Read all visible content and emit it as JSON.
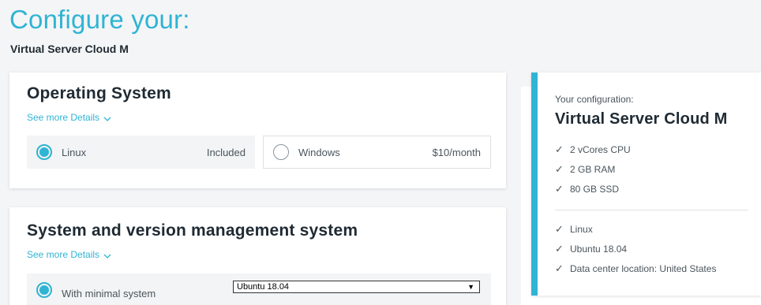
{
  "header": {
    "title": "Configure your:",
    "subtitle": "Virtual Server Cloud M"
  },
  "os_section": {
    "title": "Operating System",
    "details_link": "See more Details",
    "options": [
      {
        "label": "Linux",
        "price": "Included",
        "selected": true
      },
      {
        "label": "Windows",
        "price": "$10/month",
        "selected": false
      }
    ]
  },
  "system_section": {
    "title": "System and version management system",
    "details_link": "See more Details",
    "options": [
      {
        "label": "With minimal system",
        "selected": true
      }
    ],
    "version_select": {
      "value": "Ubuntu 18.04"
    }
  },
  "summary": {
    "caption": "Your configuration:",
    "title": "Virtual Server Cloud M",
    "specs": [
      "2 vCores CPU",
      "2 GB RAM",
      "80 GB SSD"
    ],
    "selections": [
      "Linux",
      "Ubuntu 18.04",
      "Data center location: United States"
    ]
  },
  "colors": {
    "accent": "#2fb4d4",
    "text_dark": "#1f2a33",
    "text_muted": "#4a555d",
    "background": "#f4f5f6"
  },
  "icons": {
    "details_toggle": "chevron-down-icon",
    "list_check": "check-icon"
  }
}
